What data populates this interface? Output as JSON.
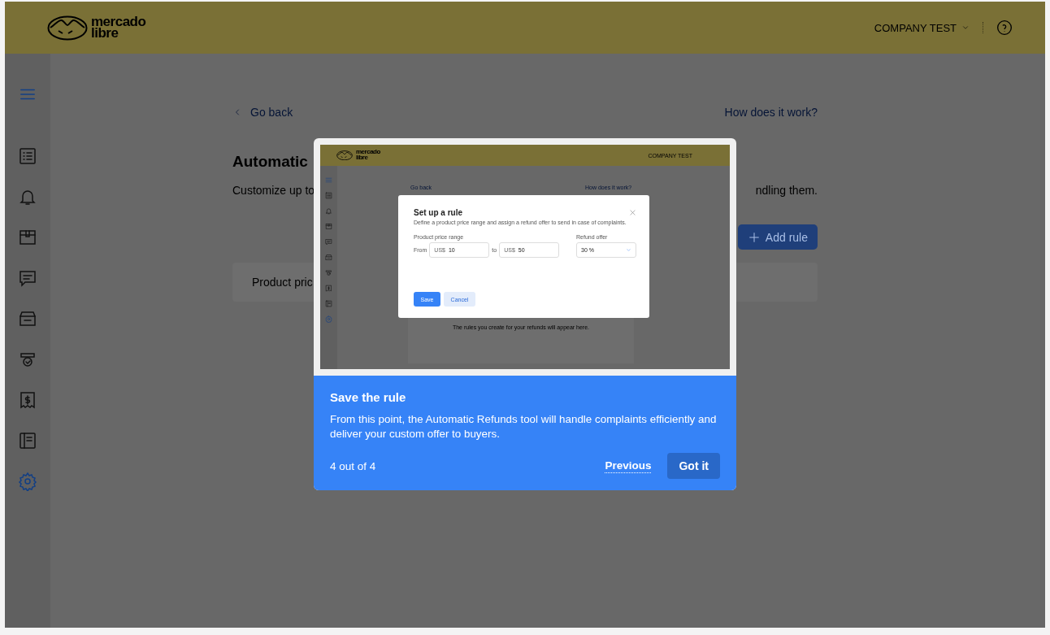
{
  "header": {
    "logo": [
      "mercado",
      "libre"
    ],
    "account": "COMPANY TEST"
  },
  "sidebar": {
    "items": [
      {
        "selected": false
      },
      {
        "selected": false
      },
      {
        "selected": false
      },
      {
        "selected": false
      },
      {
        "selected": false
      },
      {
        "selected": false
      },
      {
        "selected": false
      },
      {
        "selected": false
      },
      {
        "selected": true
      }
    ]
  },
  "page": {
    "back": "Go back",
    "help": "How does it work?",
    "title": "Automatic",
    "description_left": "Customize up to",
    "description_right": "ndling them.",
    "add_button": "Add rule",
    "card_text": "Product pric"
  },
  "tour": {
    "screenshot": {
      "logo": [
        "mercado",
        "libre"
      ],
      "account": "COMPANY TEST",
      "back": "Go back",
      "help": "How does it work?",
      "empty_message": "The rules you create for your refunds will appear here.",
      "sidebar": [
        {
          "selected": false
        },
        {
          "selected": false
        },
        {
          "selected": false
        },
        {
          "selected": false
        },
        {
          "selected": false
        },
        {
          "selected": false
        },
        {
          "selected": false
        },
        {
          "selected": false
        },
        {
          "selected": true
        }
      ],
      "modal": {
        "title": "Set up a rule",
        "description": "Define a product price range and assign a refund offer to send in case of complaints.",
        "range_label": "Product price range",
        "from_label": "From",
        "from_currency": "US$",
        "from_value": "10",
        "to_label": "to",
        "to_currency": "US$",
        "to_value": "50",
        "offer_label": "Refund offer",
        "offer_value": "30 %",
        "save": "Save",
        "cancel": "Cancel"
      }
    },
    "title": "Save the rule",
    "body": "From this point, the Automatic Refunds tool will handle complaints efficiently and deliver your custom offer to buyers.",
    "step": "4 out of 4",
    "previous": "Previous",
    "primary": "Got it"
  }
}
